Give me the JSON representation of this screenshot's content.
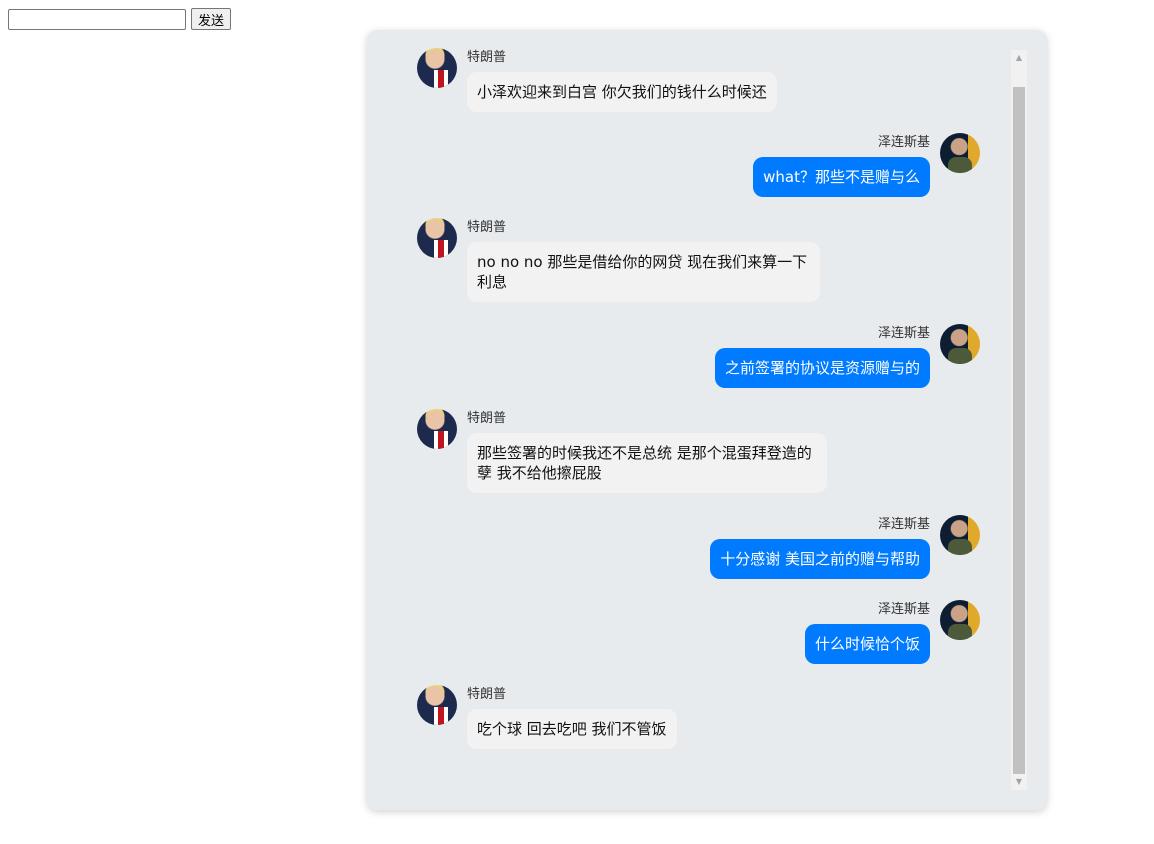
{
  "composer": {
    "input_value": "",
    "send_label": "发送"
  },
  "messages": [
    {
      "side": "left",
      "sender": "特朗普",
      "avatar": "trump-avatar",
      "text": "小泽欢迎来到白宫 你欠我们的钱什么时候还"
    },
    {
      "side": "right",
      "sender": "泽连斯基",
      "avatar": "zelensky-avatar",
      "text": "what？那些不是赠与么"
    },
    {
      "side": "left",
      "sender": "特朗普",
      "avatar": "trump-avatar",
      "text": "no no no 那些是借给你的网贷 现在我们来算一下利息"
    },
    {
      "side": "right",
      "sender": "泽连斯基",
      "avatar": "zelensky-avatar",
      "text": "之前签署的协议是资源赠与的"
    },
    {
      "side": "left",
      "sender": "特朗普",
      "avatar": "trump-avatar",
      "text": "那些签署的时候我还不是总统 是那个混蛋拜登造的孽 我不给他擦屁股"
    },
    {
      "side": "right",
      "sender": "泽连斯基",
      "avatar": "zelensky-avatar",
      "text": "十分感谢 美国之前的赠与帮助"
    },
    {
      "side": "right",
      "sender": "泽连斯基",
      "avatar": "zelensky-avatar",
      "text": "什么时候恰个饭"
    },
    {
      "side": "left",
      "sender": "特朗普",
      "avatar": "trump-avatar",
      "text": "吃个球 回去吃吧 我们不管饭"
    }
  ],
  "colors": {
    "outgoing_bubble": "#007bff",
    "incoming_bubble": "#f2f2f2",
    "panel_background": "#e8ebee"
  }
}
